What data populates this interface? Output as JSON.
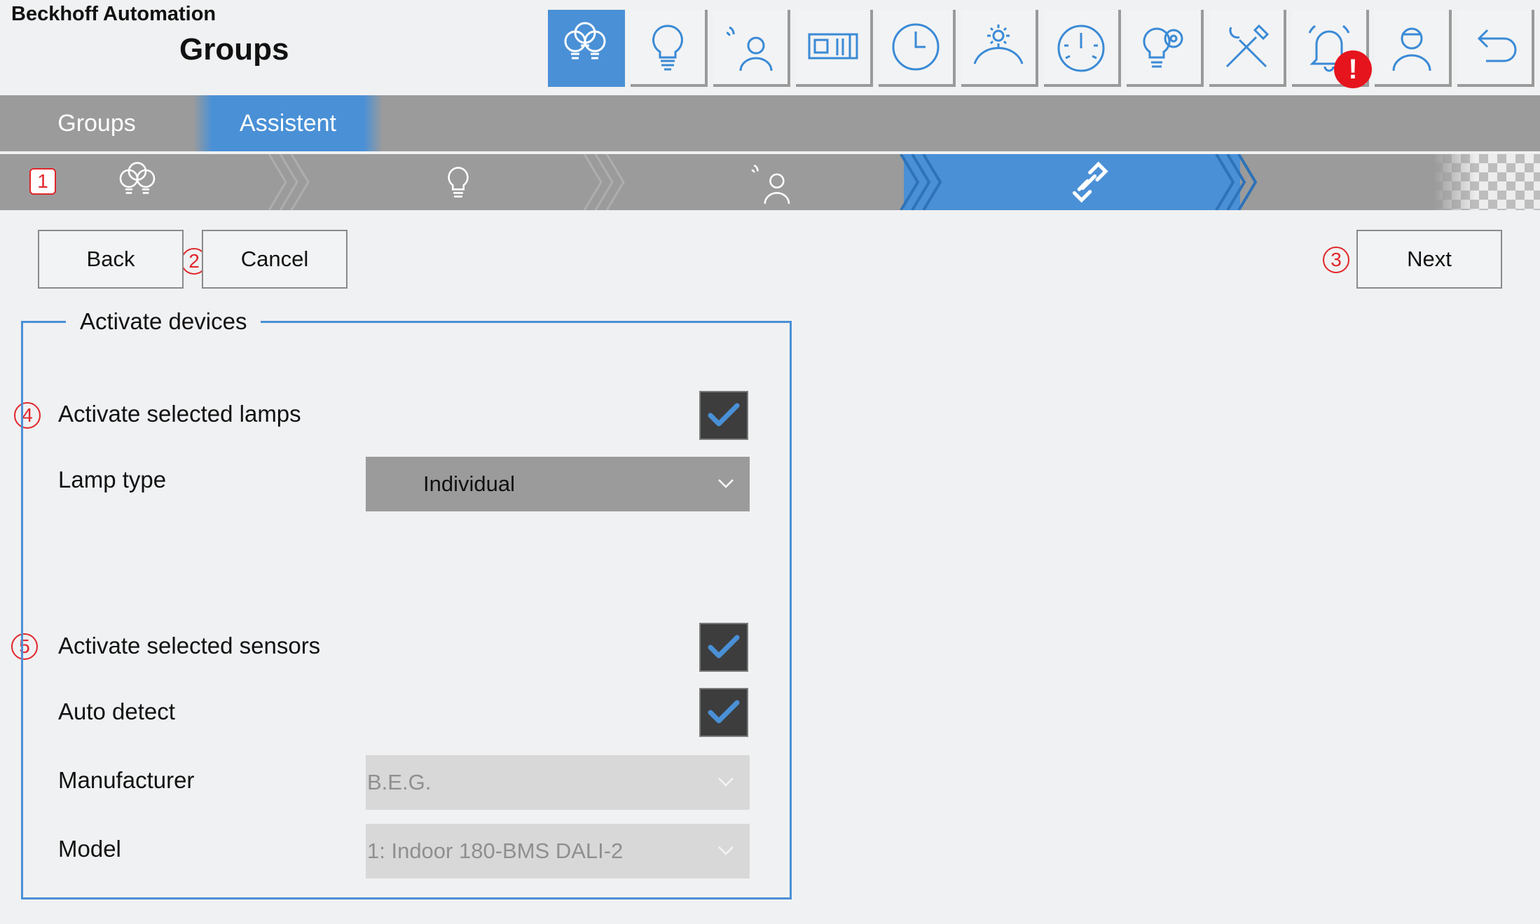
{
  "header": {
    "brand": "Beckhoff Automation",
    "title": "Groups"
  },
  "nav": {
    "buttons": [
      {
        "name": "groups",
        "icon": "lamps-group-icon",
        "active": true
      },
      {
        "name": "lamp",
        "icon": "lightbulb-icon"
      },
      {
        "name": "sensor",
        "icon": "presence-sensor-icon"
      },
      {
        "name": "blinds",
        "icon": "blinds-icon"
      },
      {
        "name": "schedule",
        "icon": "clock-icon"
      },
      {
        "name": "daylight",
        "icon": "sun-icon"
      },
      {
        "name": "meter",
        "icon": "gauge-icon"
      },
      {
        "name": "lamp-settings",
        "icon": "lamp-gear-icon"
      },
      {
        "name": "tools",
        "icon": "tools-icon"
      },
      {
        "name": "alarm",
        "icon": "bell-icon"
      },
      {
        "name": "user",
        "icon": "user-icon"
      },
      {
        "name": "back",
        "icon": "undo-icon"
      }
    ],
    "alarm_badge": "!"
  },
  "tabs": [
    {
      "label": "Groups",
      "active": false
    },
    {
      "label": "Assistent",
      "active": true
    }
  ],
  "wizard": {
    "steps": [
      "lamps-group-icon",
      "lightbulb-icon",
      "presence-sensor-icon",
      "link-icon"
    ],
    "active_step": 4
  },
  "callouts": [
    "1",
    "2",
    "3",
    "4",
    "5"
  ],
  "buttons": {
    "back": "Back",
    "cancel": "Cancel",
    "next": "Next"
  },
  "activate": {
    "legend": "Activate devices",
    "lamps_label": "Activate selected lamps",
    "lamps_checked": true,
    "lamp_type_label": "Lamp type",
    "lamp_type_value": "Individual",
    "sensors_label": "Activate selected sensors",
    "sensors_checked": true,
    "auto_detect_label": "Auto detect",
    "auto_detect_checked": true,
    "manufacturer_label": "Manufacturer",
    "manufacturer_value": "B.E.G.",
    "model_label": "Model",
    "model_value": "1: Indoor 180-BMS DALI-2"
  },
  "colors": {
    "accent": "#4a90d6",
    "bar": "#9b9b9b",
    "alert": "#e5141d",
    "callout": "#e0262b"
  }
}
